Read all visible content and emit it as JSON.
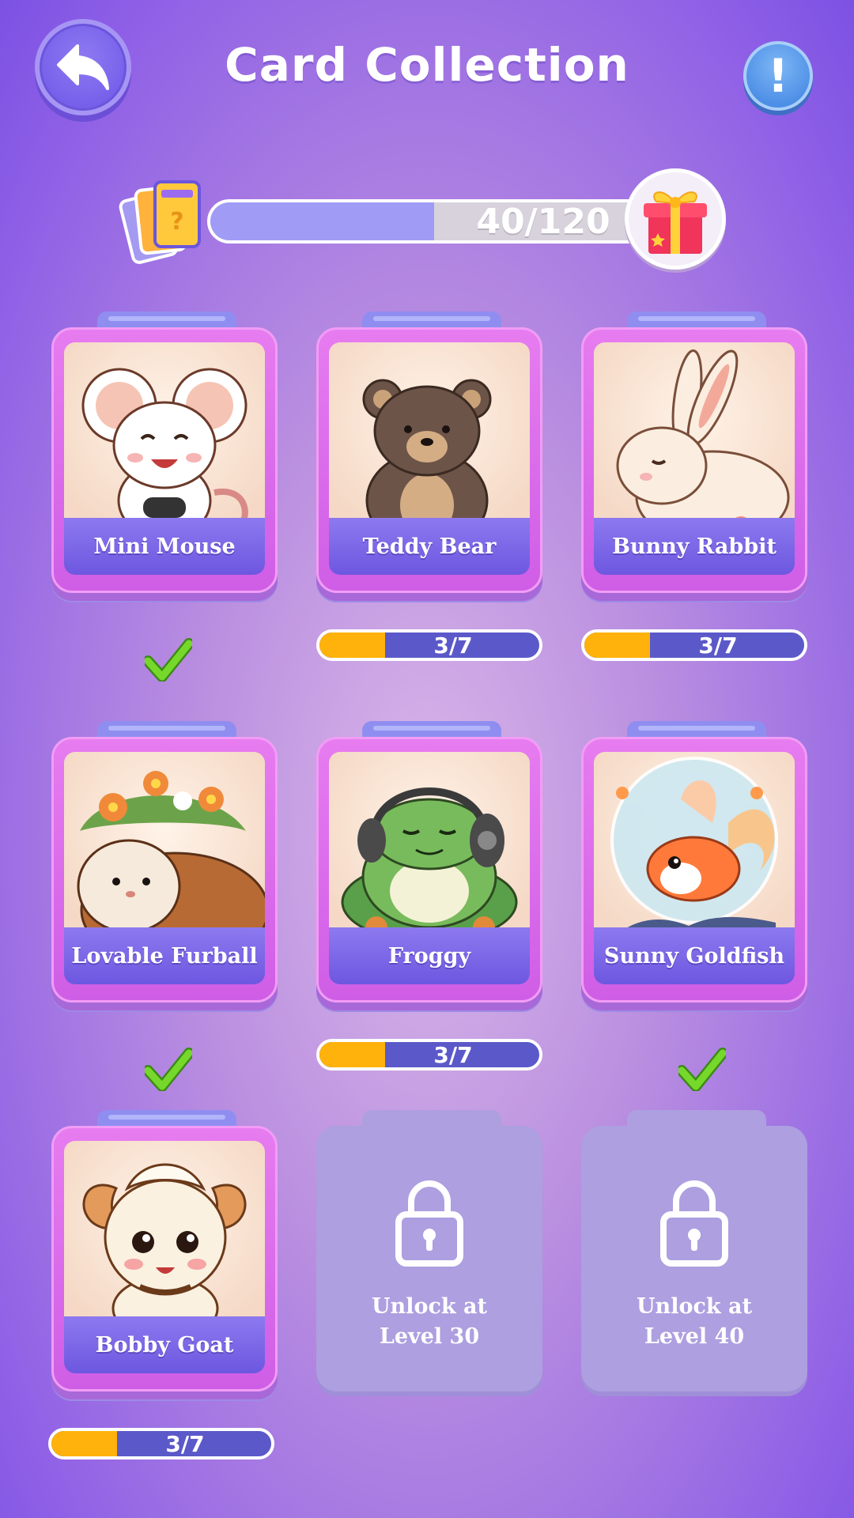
{
  "header": {
    "title": "Card Collection",
    "back_icon": "back-arrow-icon",
    "info_label": "!"
  },
  "collection_progress": {
    "current": 40,
    "total": 120,
    "label": "40/120",
    "fraction": 0.333,
    "deck_icon": "card-deck-icon",
    "reward_icon": "gift-box-icon"
  },
  "cards": [
    {
      "name": "Mini Mouse",
      "status": "complete",
      "art": "mouse"
    },
    {
      "name": "Teddy Bear",
      "status": "progress",
      "progress_label": "3/7",
      "progress": 0.4286,
      "art": "bear"
    },
    {
      "name": "Bunny Rabbit",
      "status": "progress",
      "progress_label": "3/7",
      "progress": 0.4286,
      "art": "rabbit"
    },
    {
      "name": "Lovable Furball",
      "status": "complete",
      "art": "guinea-pig"
    },
    {
      "name": "Froggy",
      "status": "progress",
      "progress_label": "3/7",
      "progress": 0.4286,
      "art": "frog"
    },
    {
      "name": "Sunny Goldfish",
      "status": "complete",
      "art": "goldfish"
    },
    {
      "name": "Bobby Goat",
      "status": "progress",
      "progress_label": "3/7",
      "progress": 0.4286,
      "art": "goat"
    },
    {
      "status": "locked",
      "lock_line1": "Unlock at",
      "lock_line2": "Level 30"
    },
    {
      "status": "locked",
      "lock_line1": "Unlock at",
      "lock_line2": "Level 40"
    }
  ],
  "colors": {
    "background": "#9a6fe5",
    "card_frame": "#e07aef",
    "name_bar": "#7a64e6",
    "progress_fill": "#ffb20b",
    "progress_track": "#5b59c9",
    "locked_card": "#ad9fe0",
    "check": "#6ed321"
  }
}
